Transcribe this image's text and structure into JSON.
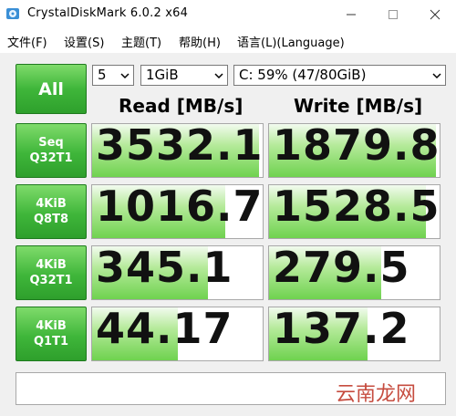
{
  "window": {
    "title": "CrystalDiskMark 6.0.2 x64",
    "controls": {
      "minimize": "—",
      "maximize": "□",
      "close": "✕"
    }
  },
  "menu": [
    {
      "label": "文件(F)"
    },
    {
      "label": "设置(S)"
    },
    {
      "label": "主题(T)"
    },
    {
      "label": "帮助(H)"
    },
    {
      "label": "语言(L)(Language)"
    }
  ],
  "toolbar": {
    "all_label": "All",
    "runs_value": "5",
    "size_value": "1GiB",
    "drive_value": "C: 59% (47/80GiB)"
  },
  "columns": {
    "read": "Read [MB/s]",
    "write": "Write [MB/s]"
  },
  "rows": [
    {
      "line1": "Seq",
      "line2": "Q32T1",
      "read": "3532.1",
      "write": "1879.8",
      "read_fill": 0.98,
      "write_fill": 0.98
    },
    {
      "line1": "4KiB",
      "line2": "Q8T8",
      "read": "1016.7",
      "write": "1528.5",
      "read_fill": 0.78,
      "write_fill": 0.92
    },
    {
      "line1": "4KiB",
      "line2": "Q32T1",
      "read": "345.1",
      "write": "279.5",
      "read_fill": 0.68,
      "write_fill": 0.66
    },
    {
      "line1": "4KiB",
      "line2": "Q1T1",
      "read": "44.17",
      "write": "137.2",
      "read_fill": 0.5,
      "write_fill": 0.58
    }
  ],
  "comment": "",
  "watermark": "云南龙网",
  "colors": {
    "button_green": "#3fb63a",
    "bar_green": "#6fd24f",
    "watermark_red": "#c0392b"
  }
}
